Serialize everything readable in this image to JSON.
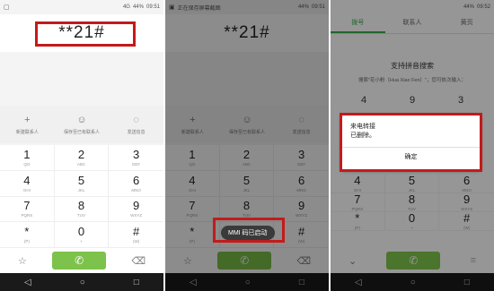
{
  "panel1": {
    "status": {
      "signal": "4G",
      "battery": "44%",
      "time": "09:51"
    },
    "number": "**21#",
    "actions": [
      {
        "icon": "plus-icon",
        "symbol": "+",
        "label": "新建联系人"
      },
      {
        "icon": "person-icon",
        "symbol": "☺",
        "label": "保存至已有联系人"
      },
      {
        "icon": "message-icon",
        "symbol": "◌",
        "label": "发送信息"
      }
    ]
  },
  "panel2": {
    "status": {
      "notification": "正在保存屏幕截图",
      "battery": "44%",
      "time": "09:51"
    },
    "number": "**21#",
    "actions": [
      {
        "icon": "plus-icon",
        "symbol": "+",
        "label": "新建联系人"
      },
      {
        "icon": "person-icon",
        "symbol": "☺",
        "label": "保存至已有联系人"
      },
      {
        "icon": "message-icon",
        "symbol": "◌",
        "label": "发送信息"
      }
    ],
    "toast": "MMI 码已启动"
  },
  "panel3": {
    "status": {
      "battery": "44%",
      "time": "09:52"
    },
    "tabs": [
      {
        "label": "拨号",
        "active": true
      },
      {
        "label": "联系人",
        "active": false
      },
      {
        "label": "黄页",
        "active": false
      }
    ],
    "search_title": "支持拼音搜索",
    "search_hint": "搜索\"花小粉（Hua Xiao Fen）\"，您可依次输入：",
    "hint_digits": [
      "4",
      "9",
      "3"
    ],
    "dialog": {
      "title": "来电转接",
      "message": "已删除。",
      "ok": "确定"
    }
  },
  "keys": [
    {
      "d": "1",
      "l": "QO"
    },
    {
      "d": "2",
      "l": "ABC"
    },
    {
      "d": "3",
      "l": "DEF"
    },
    {
      "d": "4",
      "l": "GHI"
    },
    {
      "d": "5",
      "l": "JKL"
    },
    {
      "d": "6",
      "l": "MNO"
    },
    {
      "d": "7",
      "l": "PQRS"
    },
    {
      "d": "8",
      "l": "TUV"
    },
    {
      "d": "9",
      "l": "WXYZ"
    },
    {
      "d": "*",
      "l": "(P)"
    },
    {
      "d": "0",
      "l": "+"
    },
    {
      "d": "#",
      "l": "(W)"
    }
  ],
  "colors": {
    "call_green": "#7dc24a",
    "highlight_red": "#c41a1a",
    "tab_green": "#3aa84a"
  }
}
